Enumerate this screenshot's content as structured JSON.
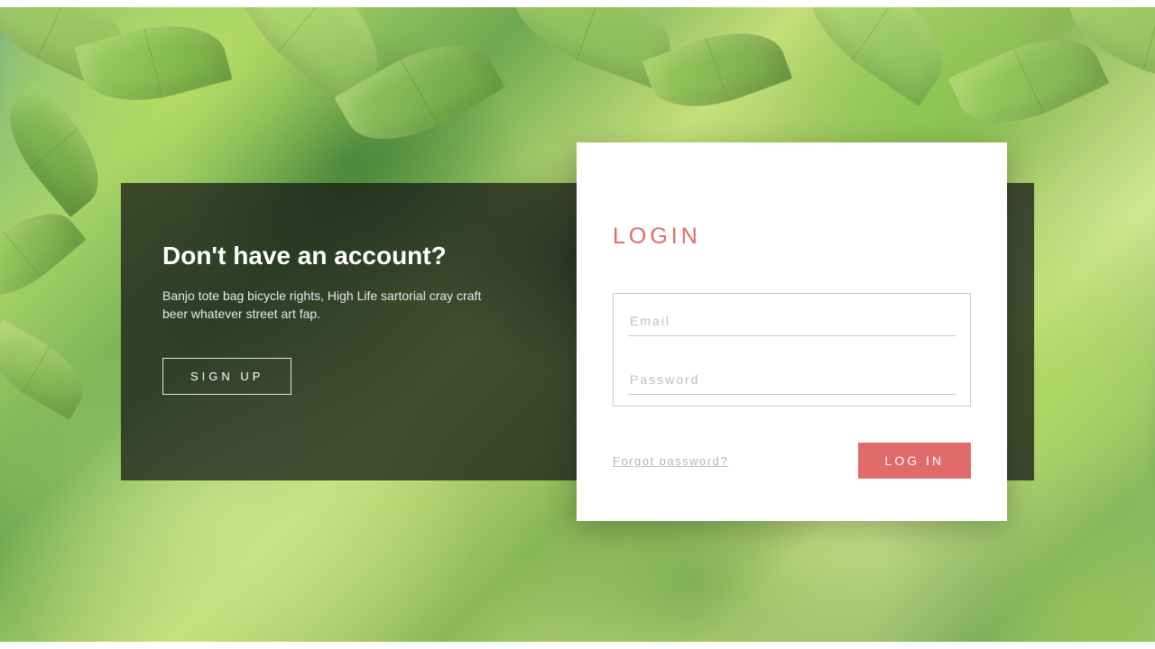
{
  "colors": {
    "accent": "#e16a6a"
  },
  "signup": {
    "heading": "Don't have an account?",
    "text": "Banjo tote bag bicycle rights, High Life sartorial cray craft beer whatever street art fap.",
    "button_label": "SIGN UP"
  },
  "login": {
    "title": "LOGIN",
    "email_placeholder": "Email",
    "email_value": "",
    "password_placeholder": "Password",
    "password_value": "",
    "forgot_label": "Forgot password?",
    "submit_label": "LOG IN"
  }
}
